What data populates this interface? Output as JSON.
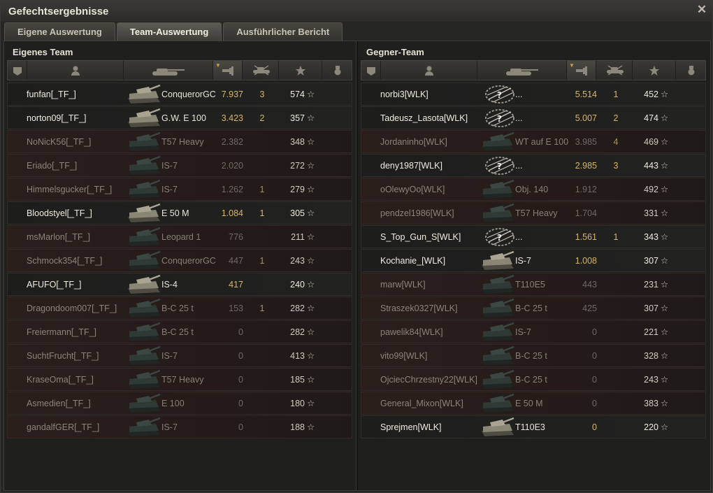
{
  "window": {
    "title": "Gefechtsergebnisse"
  },
  "tabs": [
    {
      "label": "Eigene Auswertung",
      "active": false
    },
    {
      "label": "Team-Auswertung",
      "active": true
    },
    {
      "label": "Ausführlicher Bericht",
      "active": false
    }
  ],
  "columns": [
    "squad-icon",
    "player-icon",
    "tank-icon",
    "damage-icon",
    "kills-icon",
    "xp-star-icon",
    "medal-icon"
  ],
  "own_team": {
    "title": "Eigenes Team",
    "players": [
      {
        "name": "funfan[_TF_]",
        "tank": "ConquerorGC",
        "damage": "7.937",
        "kills": "3",
        "xp": "574",
        "alive": true
      },
      {
        "name": "norton09[_TF_]",
        "tank": "G.W. E 100",
        "damage": "3.423",
        "kills": "2",
        "xp": "357",
        "alive": true
      },
      {
        "name": "NoNicK56[_TF_]",
        "tank": "T57 Heavy",
        "damage": "2.382",
        "kills": "",
        "xp": "348",
        "alive": false
      },
      {
        "name": "Eriado[_TF_]",
        "tank": "IS-7",
        "damage": "2.020",
        "kills": "",
        "xp": "272",
        "alive": false
      },
      {
        "name": "Himmelsgucker[_TF_]",
        "tank": "IS-7",
        "damage": "1.262",
        "kills": "1",
        "xp": "279",
        "alive": false
      },
      {
        "name": "Bloodstyel[_TF_]",
        "tank": "E 50 M",
        "damage": "1.084",
        "kills": "1",
        "xp": "305",
        "alive": true
      },
      {
        "name": "msMarlon[_TF_]",
        "tank": "Leopard 1",
        "damage": "776",
        "kills": "",
        "xp": "211",
        "alive": false
      },
      {
        "name": "Schmock354[_TF_]",
        "tank": "ConquerorGC",
        "damage": "447",
        "kills": "1",
        "xp": "243",
        "alive": false
      },
      {
        "name": "AFUFO[_TF_]",
        "tank": "IS-4",
        "damage": "417",
        "kills": "",
        "xp": "240",
        "alive": true
      },
      {
        "name": "Dragondoom007[_TF_]",
        "tank": "B-C 25 t",
        "damage": "153",
        "kills": "1",
        "xp": "282",
        "alive": false
      },
      {
        "name": "Freiermann[_TF_]",
        "tank": "B-C 25 t",
        "damage": "0",
        "kills": "",
        "xp": "282",
        "alive": false
      },
      {
        "name": "SuchtFrucht[_TF_]",
        "tank": "IS-7",
        "damage": "0",
        "kills": "",
        "xp": "413",
        "alive": false
      },
      {
        "name": "KraseOma[_TF_]",
        "tank": "T57 Heavy",
        "damage": "0",
        "kills": "",
        "xp": "185",
        "alive": false
      },
      {
        "name": "Asmedien[_TF_]",
        "tank": "E 100",
        "damage": "0",
        "kills": "",
        "xp": "180",
        "alive": false
      },
      {
        "name": "gandalfGER[_TF_]",
        "tank": "IS-7",
        "damage": "0",
        "kills": "",
        "xp": "188",
        "alive": false
      }
    ]
  },
  "enemy_team": {
    "title": "Gegner-Team",
    "players": [
      {
        "name": "norbi3[WLK]",
        "tank": "...",
        "damage": "5.514",
        "kills": "1",
        "xp": "452",
        "alive": true,
        "unknown": true
      },
      {
        "name": "Tadeusz_Lasota[WLK]",
        "tank": "...",
        "damage": "5.007",
        "kills": "2",
        "xp": "474",
        "alive": true,
        "unknown": true
      },
      {
        "name": "Jordaninho[WLK]",
        "tank": "WT auf E 100",
        "damage": "3.985",
        "kills": "4",
        "xp": "469",
        "alive": false
      },
      {
        "name": "deny1987[WLK]",
        "tank": "...",
        "damage": "2.985",
        "kills": "3",
        "xp": "443",
        "alive": true,
        "unknown": true
      },
      {
        "name": "oOlewyOo[WLK]",
        "tank": "Obj. 140",
        "damage": "1.912",
        "kills": "",
        "xp": "492",
        "alive": false
      },
      {
        "name": "pendzel1986[WLK]",
        "tank": "T57 Heavy",
        "damage": "1.704",
        "kills": "",
        "xp": "331",
        "alive": false
      },
      {
        "name": "S_Top_Gun_S[WLK]",
        "tank": "...",
        "damage": "1.561",
        "kills": "1",
        "xp": "343",
        "alive": true,
        "unknown": true
      },
      {
        "name": "Kochanie_[WLK]",
        "tank": "IS-7",
        "damage": "1.008",
        "kills": "",
        "xp": "307",
        "alive": true
      },
      {
        "name": "marw[WLK]",
        "tank": "T110E5",
        "damage": "443",
        "kills": "",
        "xp": "231",
        "alive": false
      },
      {
        "name": "Straszek0327[WLK]",
        "tank": "B-C 25 t",
        "damage": "425",
        "kills": "",
        "xp": "307",
        "alive": false
      },
      {
        "name": "pawelik84[WLK]",
        "tank": "IS-7",
        "damage": "0",
        "kills": "",
        "xp": "221",
        "alive": false
      },
      {
        "name": "vito99[WLK]",
        "tank": "B-C 25 t",
        "damage": "0",
        "kills": "",
        "xp": "328",
        "alive": false
      },
      {
        "name": "OjciecChrzestny22[WLK]",
        "tank": "B-C 25 t",
        "damage": "0",
        "kills": "",
        "xp": "243",
        "alive": false
      },
      {
        "name": "General_Mixon[WLK]",
        "tank": "E 50 M",
        "damage": "0",
        "kills": "",
        "xp": "383",
        "alive": false
      },
      {
        "name": "Sprejmen[WLK]",
        "tank": "T110E3",
        "damage": "0",
        "kills": "",
        "xp": "220",
        "alive": true
      }
    ]
  },
  "colors": {
    "accent": "#d4b66a",
    "dead_row": "#2b1f1c",
    "alive_text": "#f0ece0",
    "dead_text": "#8a857c"
  }
}
